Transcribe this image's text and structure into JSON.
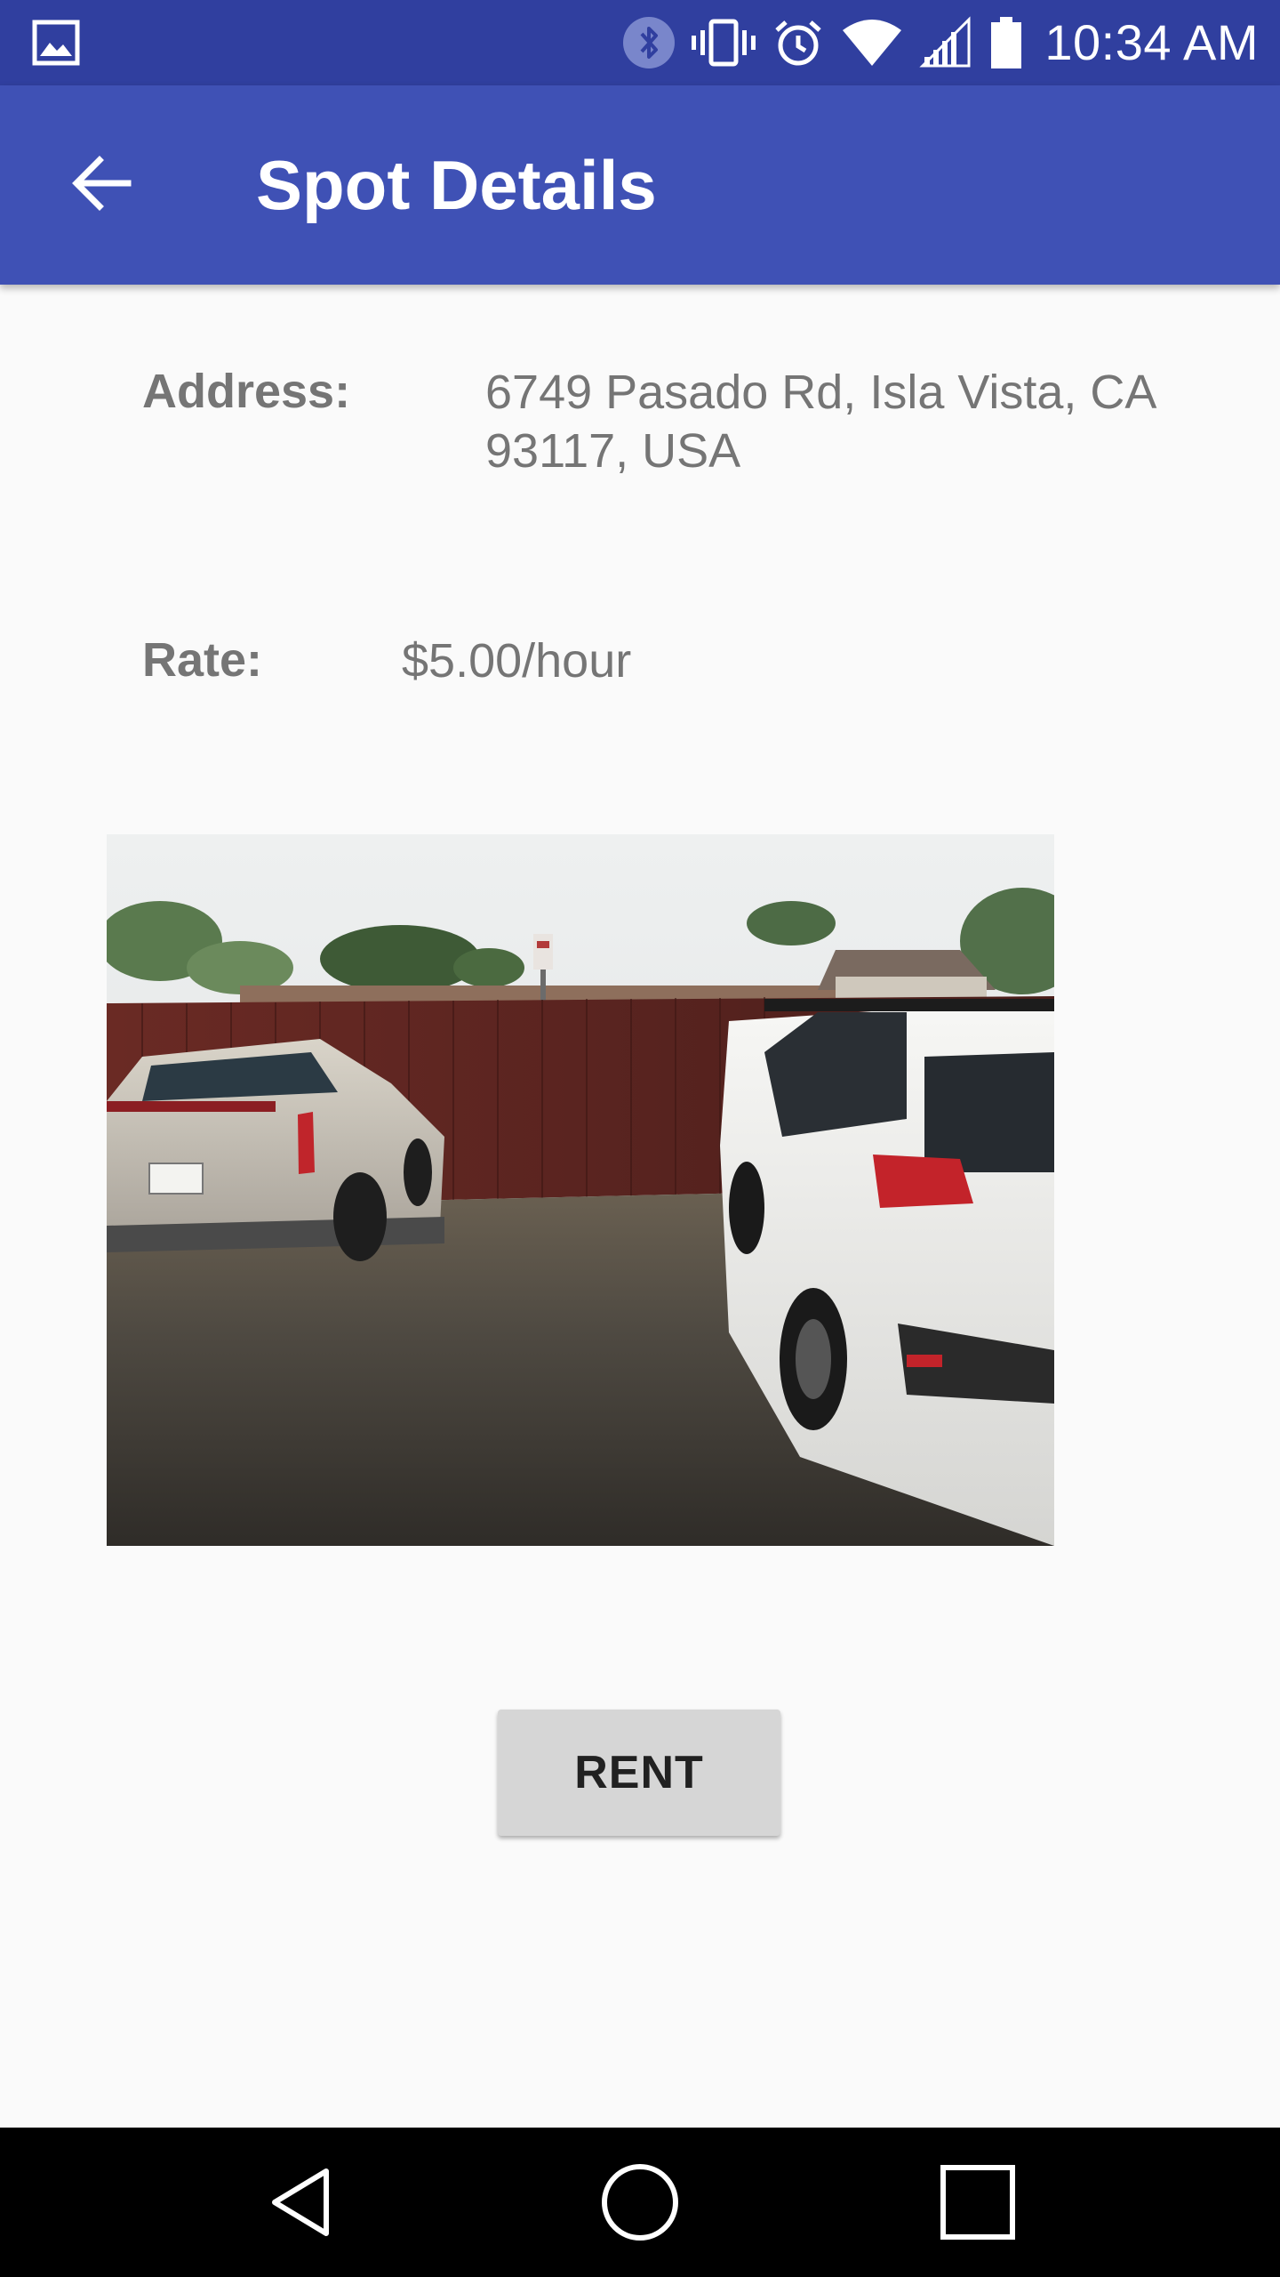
{
  "status_bar": {
    "time": "10:34 AM",
    "icons": [
      "gallery-icon",
      "bluetooth-icon",
      "vibrate-icon",
      "alarm-icon",
      "wifi-icon",
      "signal-icon",
      "battery-icon"
    ]
  },
  "app_bar": {
    "title": "Spot Details",
    "back_icon": "arrow-back-icon"
  },
  "details": {
    "address_label": "Address:",
    "address_value": "6749 Pasado Rd, Isla Vista, CA 93117, USA",
    "rate_label": "Rate:",
    "rate_value": "$5.00/hour"
  },
  "photo": {
    "alt": "Photo of parking spot"
  },
  "actions": {
    "rent_label": "RENT"
  },
  "nav_bar": {
    "icons": [
      "nav-back-icon",
      "nav-home-icon",
      "nav-recents-icon"
    ]
  },
  "colors": {
    "status_bar": "#303f9f",
    "app_bar": "#3f51b5",
    "background": "#fafafa",
    "label_text": "#757575",
    "button_bg": "#d6d6d6"
  }
}
